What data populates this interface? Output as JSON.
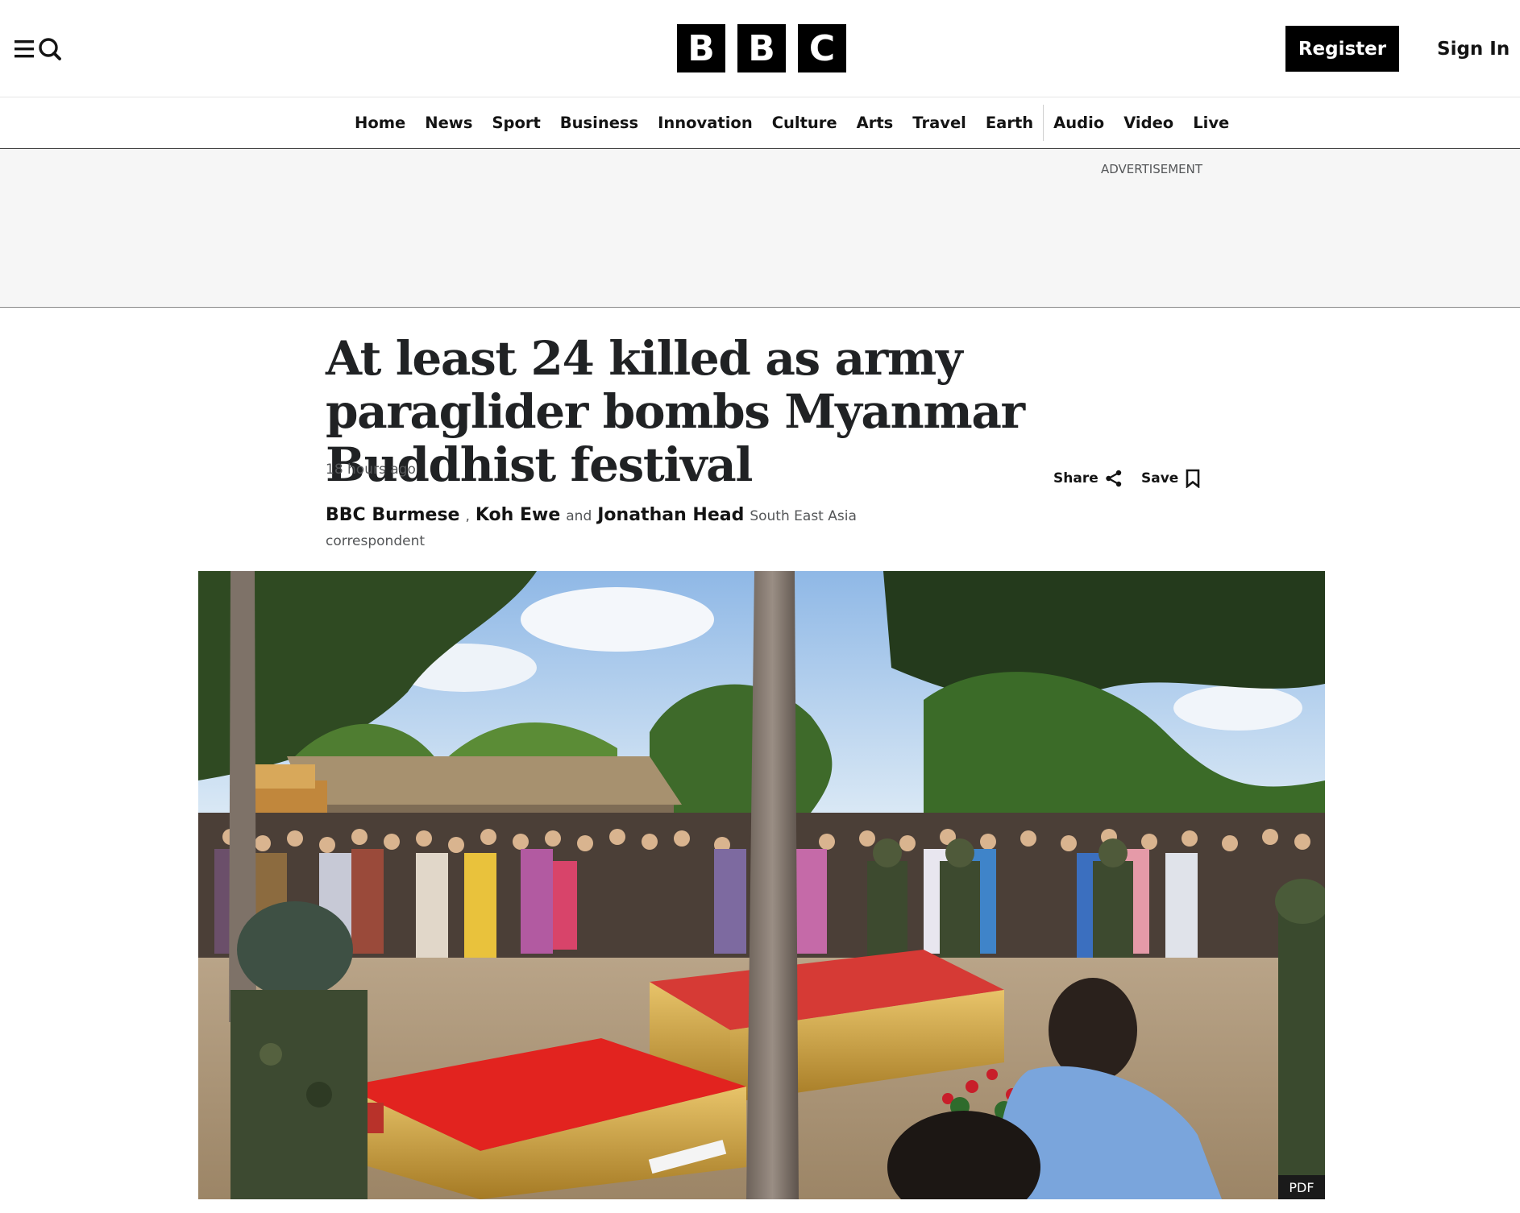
{
  "header": {
    "logo_letters": [
      "B",
      "B",
      "C"
    ],
    "register_label": "Register",
    "signin_label": "Sign In",
    "menu_icon": "menu-search-icon"
  },
  "nav": {
    "items": [
      "Home",
      "News",
      "Sport",
      "Business",
      "Innovation",
      "Culture",
      "Arts",
      "Travel",
      "Earth",
      "Audio",
      "Video",
      "Live"
    ]
  },
  "ad": {
    "label": "ADVERTISEMENT"
  },
  "article": {
    "headline": "At least 24 killed as army paraglider bombs Myanmar Buddhist festival",
    "timestamp": "18 hours ago",
    "share_label": "Share",
    "save_label": "Save",
    "byline": {
      "author1": "BBC Burmese",
      "comma": ",",
      "author2": "Koh Ewe",
      "and": "and",
      "author3": "Jonathan Head",
      "role": "South East Asia correspondent"
    },
    "image_badge": "PDF"
  },
  "colors": {
    "brand_black": "#000000",
    "text_secondary": "#545658",
    "ad_background": "#f6f6f6"
  }
}
